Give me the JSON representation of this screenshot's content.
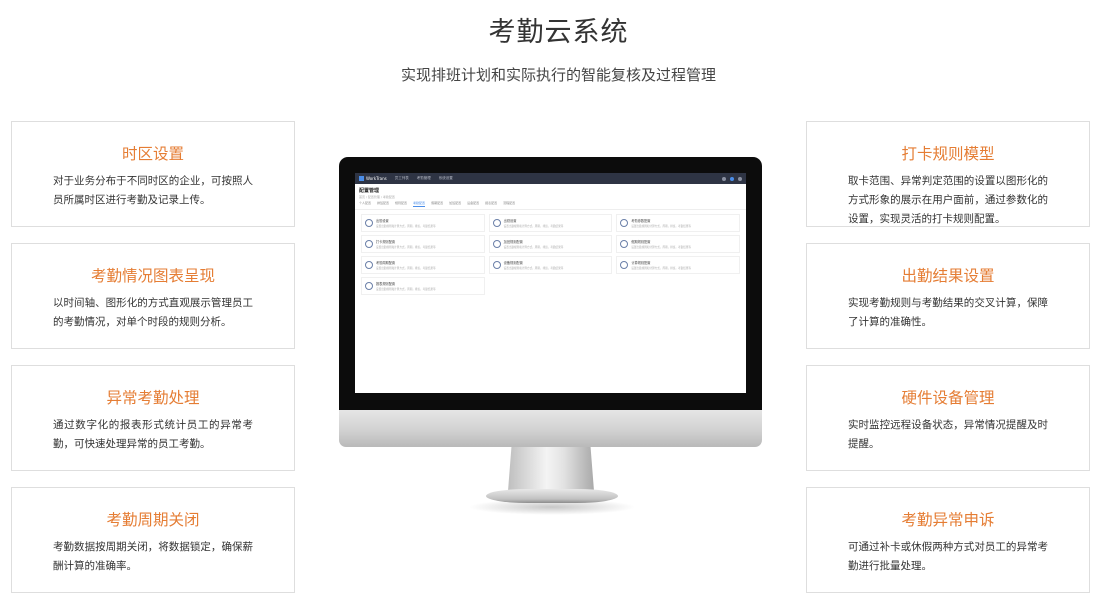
{
  "header": {
    "title": "考勤云系统",
    "subtitle": "实现排班计划和实际执行的智能复核及过程管理"
  },
  "cards_left": [
    {
      "title": "时区设置",
      "desc": "对于业务分布于不同时区的企业，可按照人员所属时区进行考勤及记录上传。"
    },
    {
      "title": "考勤情况图表呈现",
      "desc": "以时间轴、图形化的方式直观展示管理员工的考勤情况，对单个时段的规则分析。"
    },
    {
      "title": "异常考勤处理",
      "desc": "通过数字化的报表形式统计员工的异常考勤，可快速处理异常的员工考勤。"
    },
    {
      "title": "考勤周期关闭",
      "desc": "考勤数据按周期关闭，将数据锁定，确保薪酬计算的准确率。"
    }
  ],
  "cards_right": [
    {
      "title": "打卡规则模型",
      "desc": "取卡范围、异常判定范围的设置以图形化的方式形象的展示在用户面前，通过参数化的设置，实现灵活的打卡规则配置。"
    },
    {
      "title": "出勤结果设置",
      "desc": "实现考勤规则与考勤结果的交叉计算，保障了计算的准确性。"
    },
    {
      "title": "硬件设备管理",
      "desc": "实时监控远程设备状态，异常情况提醒及时提醒。"
    },
    {
      "title": "考勤异常申诉",
      "desc": "可通过补卡或休假两种方式对员工的异常考勤进行批量处理。"
    }
  ],
  "screen_app": {
    "logo": "WorkTrans",
    "nav": [
      "员工列表",
      "考勤管理",
      "系统设置"
    ],
    "heading": "配置管理",
    "crumb": "首页 / 配置管理 / 考勤配置",
    "tabs": [
      "个人配置",
      "排班配置",
      "规则配置",
      "考勤配置",
      "假期配置",
      "加班配置",
      "设备配置",
      "报表配置",
      "流程配置"
    ],
    "tiles": [
      {
        "title": "出勤设置",
        "sub": "设置出勤规则和计算方式，周期，排班，考勤结果等"
      },
      {
        "title": "出勤设置",
        "sub": "设置出勤规则和计算方式，周期，排班，考勤结果等"
      },
      {
        "title": "考勤参数配置",
        "sub": "设置出勤规则和计算方式，周期，排班，考勤结果等"
      },
      {
        "title": "打卡规则配置",
        "sub": "设置出勤规则和计算方式，周期，排班，考勤结果等"
      },
      {
        "title": "加班规则配置",
        "sub": "设置出勤规则和计算方式，周期，排班，考勤结果等"
      },
      {
        "title": "假期规则配置",
        "sub": "设置出勤规则和计算方式，周期，排班，考勤结果等"
      },
      {
        "title": "考勤周期配置",
        "sub": "设置出勤规则和计算方式，周期，排班，考勤结果等"
      },
      {
        "title": "设备规则配置",
        "sub": "设置出勤规则和计算方式，周期，排班，考勤结果等"
      },
      {
        "title": "计算规则配置",
        "sub": "设置出勤规则和计算方式，周期，排班，考勤结果等"
      },
      {
        "title": "报表规则配置",
        "sub": "设置出勤规则和计算方式，周期，排班，考勤结果等"
      }
    ]
  },
  "colors": {
    "accent": "#e57d34",
    "text": "#333333",
    "border": "#dedede"
  }
}
